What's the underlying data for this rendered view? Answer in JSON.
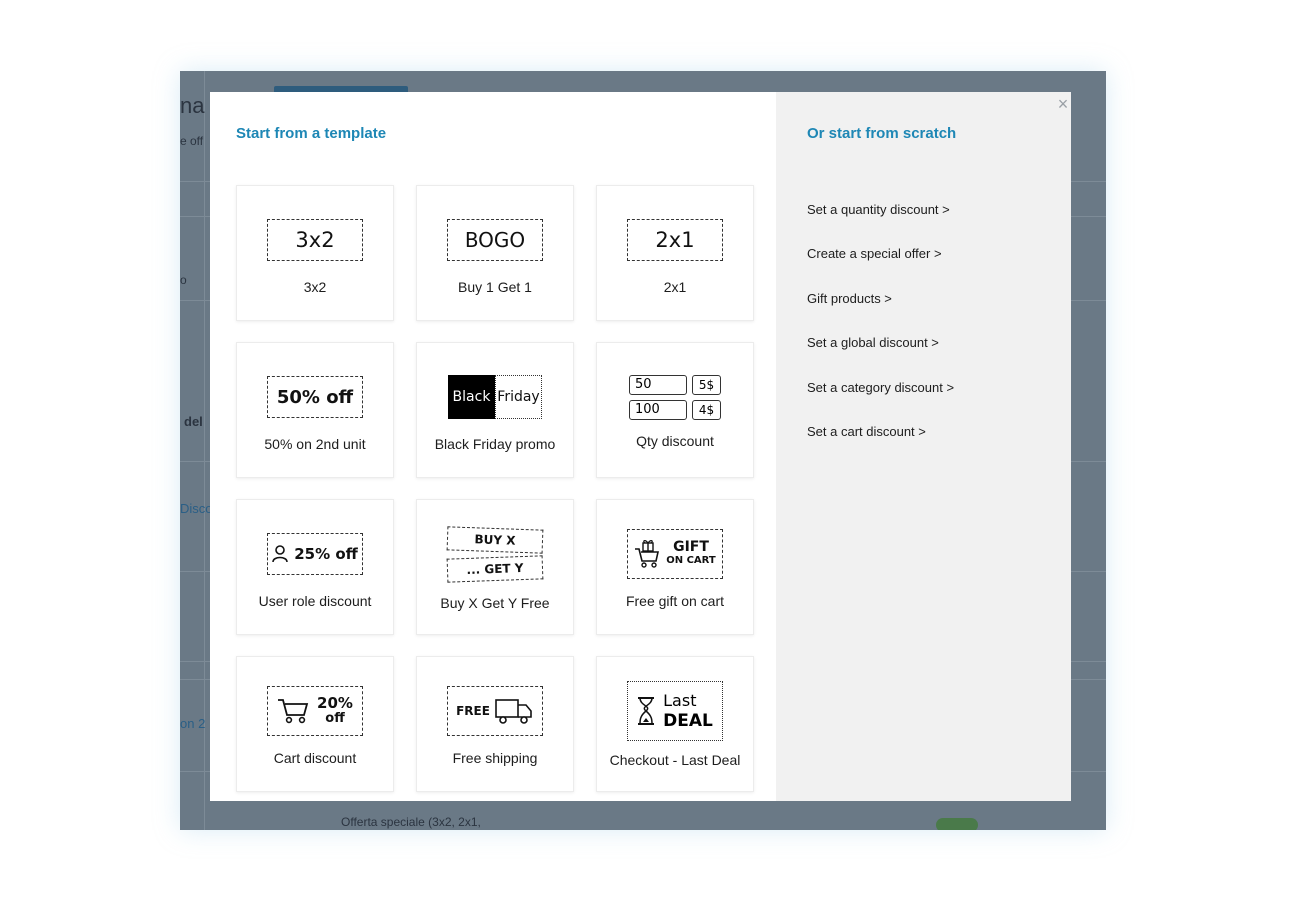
{
  "background": {
    "fragments": [
      "na",
      "e off",
      "o",
      "del",
      "Disco",
      "on 2",
      "Offerta speciale (3x2, 2x1,"
    ]
  },
  "modal": {
    "left_title": "Start from a template",
    "right_title": "Or start from scratch",
    "close_glyph": "×",
    "templates": [
      {
        "label": "3x2",
        "icon": "3x2-icon",
        "icon_text": "3x2"
      },
      {
        "label": "Buy 1 Get 1",
        "icon": "bogo-icon",
        "icon_text": "BOGO"
      },
      {
        "label": "2x1",
        "icon": "2x1-icon",
        "icon_text": "2x1"
      },
      {
        "label": "50% on 2nd unit",
        "icon": "percent-off-icon",
        "icon_text": "50% off"
      },
      {
        "label": "Black Friday promo",
        "icon": "black-friday-icon",
        "icon_text": [
          "Black",
          "Friday"
        ]
      },
      {
        "label": "Qty discount",
        "icon": "qty-table-icon",
        "icon_text": [
          [
            "50",
            "5$"
          ],
          [
            "100",
            "4$"
          ]
        ]
      },
      {
        "label": "User role discount",
        "icon": "user-role-icon",
        "icon_text": "25% off"
      },
      {
        "label": "Buy X Get Y Free",
        "icon": "buy-x-get-y-icon",
        "icon_text": [
          "BUY X",
          "... GET Y"
        ]
      },
      {
        "label": "Free gift on cart",
        "icon": "gift-cart-icon",
        "icon_text": [
          "GIFT",
          "ON CART"
        ]
      },
      {
        "label": "Cart discount",
        "icon": "cart-discount-icon",
        "icon_text": [
          "20%",
          "off"
        ]
      },
      {
        "label": "Free shipping",
        "icon": "truck-icon",
        "icon_text": "FREE"
      },
      {
        "label": "Checkout - Last Deal",
        "icon": "hourglass-icon",
        "icon_text": [
          "Last",
          "DEAL"
        ]
      }
    ],
    "scratch_options": [
      "Set a quantity discount >",
      "Create a special offer >",
      "Gift products >",
      "Set a global discount >",
      "Set a category discount >",
      "Set a cart discount >"
    ]
  },
  "colors": {
    "accent": "#1e87b5",
    "overlay": "#6a7986",
    "right_panel": "#f1f1f1"
  }
}
